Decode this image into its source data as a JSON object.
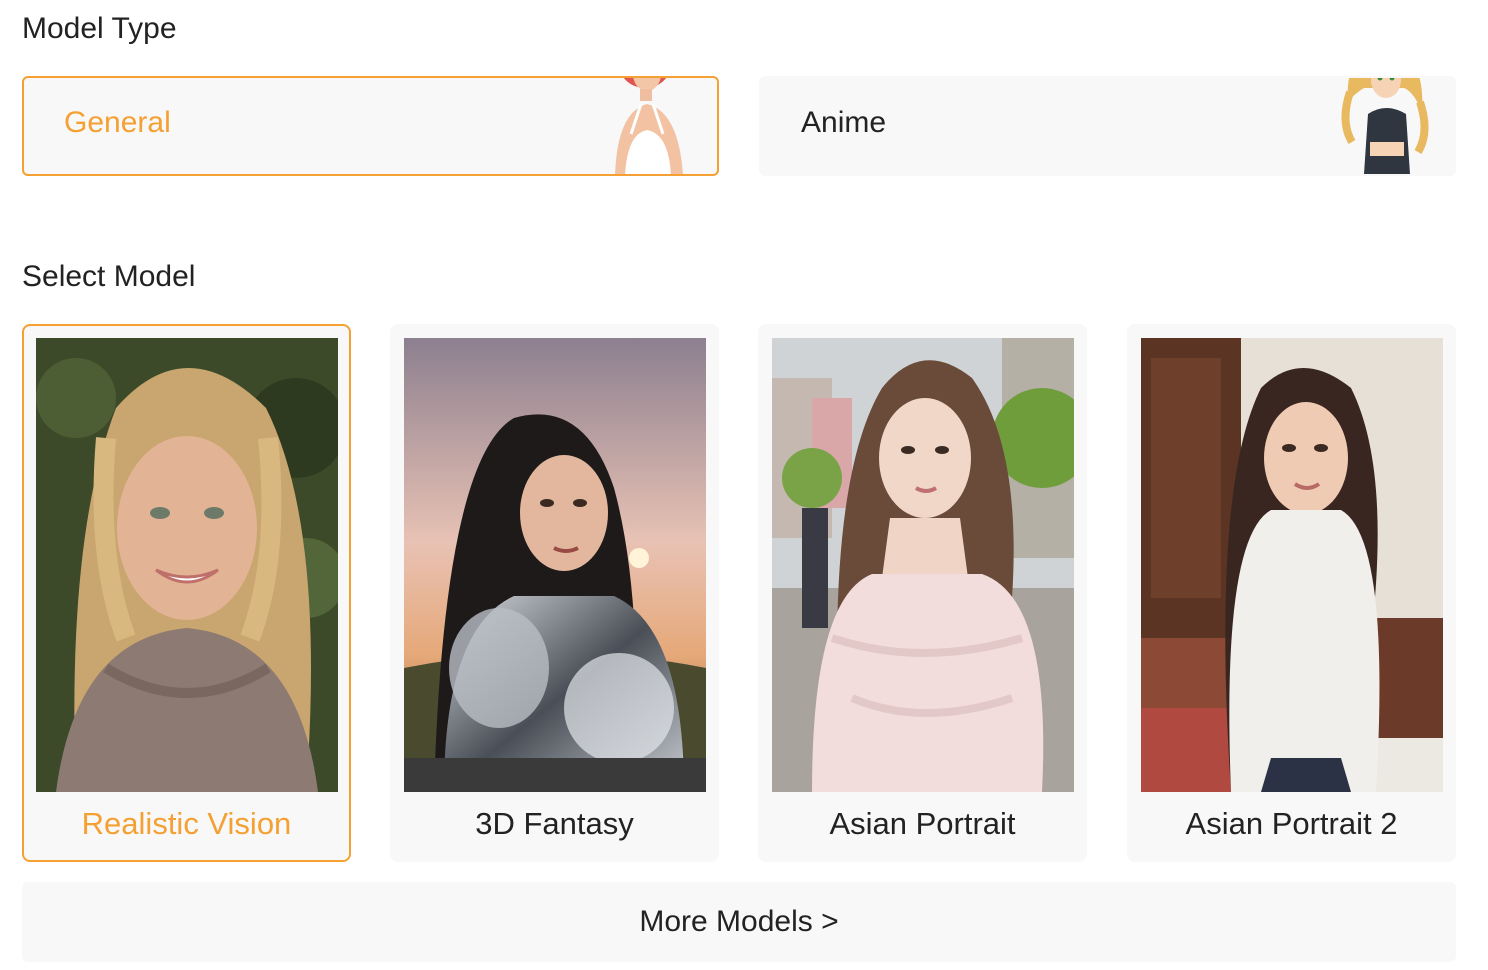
{
  "model_type": {
    "title": "Model Type",
    "options": [
      {
        "label": "General",
        "selected": true
      },
      {
        "label": "Anime",
        "selected": false
      }
    ]
  },
  "select_model": {
    "title": "Select Model",
    "models": [
      {
        "label": "Realistic Vision",
        "selected": true
      },
      {
        "label": "3D Fantasy",
        "selected": false
      },
      {
        "label": "Asian Portrait",
        "selected": false
      },
      {
        "label": "Asian Portrait 2",
        "selected": false
      }
    ]
  },
  "more_button": {
    "label": "More Models >"
  },
  "colors": {
    "accent": "#f5a033",
    "card_bg": "#f8f8f8",
    "text": "#222222"
  }
}
